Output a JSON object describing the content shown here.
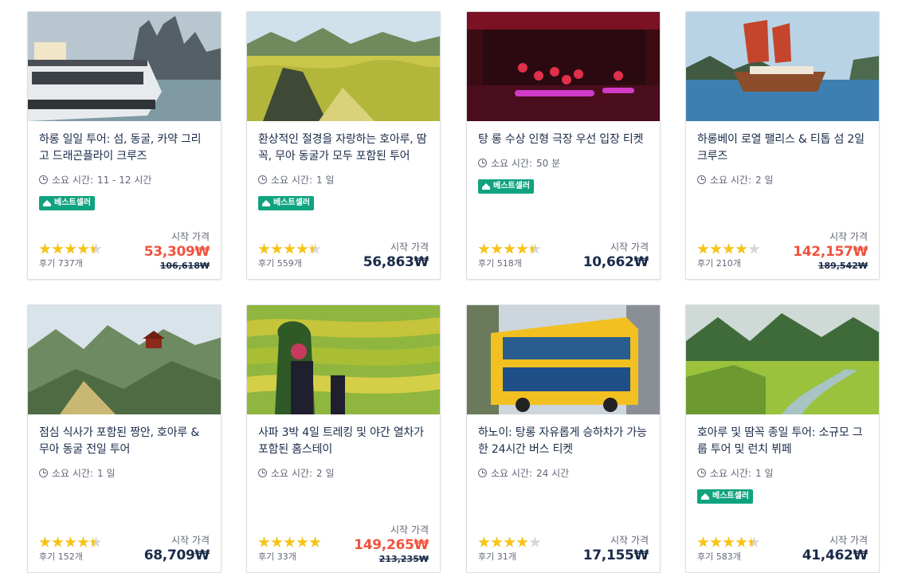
{
  "colors": {
    "accent_sale": "#f0533f",
    "badge": "#10a37f",
    "star": "#f7c413",
    "text": "#1a2b49"
  },
  "labels": {
    "duration_prefix": "소요 시간:",
    "from_price": "시작 가격",
    "bestseller": "베스트셀러",
    "review_prefix": "후기"
  },
  "cards": [
    {
      "title": "하롱 일일 투어: 섬, 동굴, 카약 그리고 드래곤플라이 크루즈",
      "duration": "11 - 12 시간",
      "bestseller": true,
      "rating": 4.5,
      "reviews": "737개",
      "price": "53,309₩",
      "old_price": "106,618₩",
      "image": "cruise-boat-karst"
    },
    {
      "title": "환상적인 절경을 자랑하는 호아루, 땀꼭, 무아 동굴가 모두 포함된 투어",
      "duration": "1 일",
      "bestseller": true,
      "rating": 4.5,
      "reviews": "559개",
      "price": "56,863₩",
      "old_price": "",
      "image": "rice-fields-mountains"
    },
    {
      "title": "탕 롱 수상 인형 극장 우선 입장 티켓",
      "duration": "50 분",
      "bestseller": true,
      "rating": 4.5,
      "reviews": "518개",
      "price": "10,662₩",
      "old_price": "",
      "image": "water-puppet-stage"
    },
    {
      "title": "하롱베이 로열 팰리스 & 티톱 섬 2일 크루즈",
      "duration": "2 일",
      "bestseller": false,
      "rating": 4,
      "reviews": "210개",
      "price": "142,157₩",
      "old_price": "189,542₩",
      "image": "junk-sail-boat"
    },
    {
      "title": "점심 식사가 포함된 짱안, 호아루 & 무아 동굴 전일 투어",
      "duration": "1 일",
      "bestseller": false,
      "rating": 4.5,
      "reviews": "152개",
      "price": "68,709₩",
      "old_price": "",
      "image": "mountain-pagoda"
    },
    {
      "title": "사파 3박 4일 트레킹 및 야간 열차가 포함된 홈스테이",
      "duration": "2 일",
      "bestseller": false,
      "rating": 5,
      "reviews": "33개",
      "price": "149,265₩",
      "old_price": "213,235₩",
      "image": "rice-terraces"
    },
    {
      "title": "하노이: 탕롱 자유롭게 승하차가 가능한 24시간 버스 티켓",
      "duration": "24 시간",
      "bestseller": false,
      "rating": 4,
      "reviews": "31개",
      "price": "17,155₩",
      "old_price": "",
      "image": "city-tour-bus"
    },
    {
      "title": "호아루 및 땀꼭 종일 투어: 소규모 그룹 투어 및 런치 뷔페",
      "duration": "1 일",
      "bestseller": true,
      "rating": 4.5,
      "reviews": "583개",
      "price": "41,462₩",
      "old_price": "",
      "image": "river-valley"
    }
  ]
}
